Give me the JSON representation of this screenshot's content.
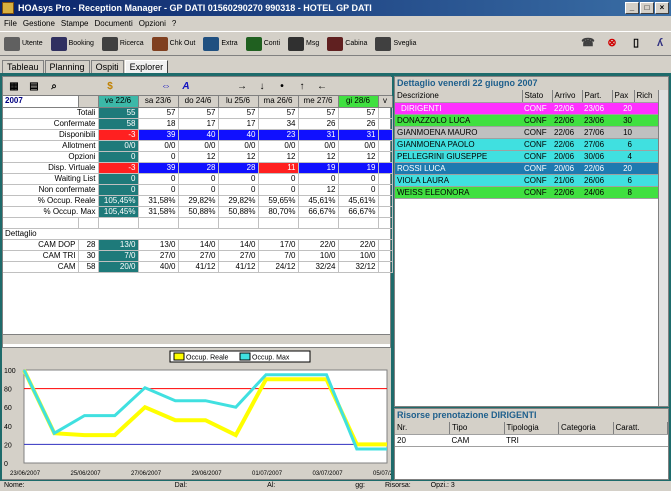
{
  "window": {
    "title": "HOAsys Pro - Reception Manager - GP DATI 01560290270 990318 - HOTEL GP DATI"
  },
  "menu": [
    "File",
    "Gestione",
    "Stampe",
    "Documenti",
    "Opzioni",
    "?"
  ],
  "toolbar": [
    {
      "label": "Utente",
      "color": "#606060"
    },
    {
      "label": "Booking",
      "color": "#303060"
    },
    {
      "label": "Ricerca",
      "color": "#404040"
    },
    {
      "label": "Chk Out",
      "color": "#804020"
    },
    {
      "label": "Extra",
      "color": "#205080"
    },
    {
      "label": "Conti",
      "color": "#206020"
    },
    {
      "label": "Msg",
      "color": "#303030"
    },
    {
      "label": "Cabina",
      "color": "#602020"
    },
    {
      "label": "Sveglia",
      "color": "#404040"
    }
  ],
  "tabs": [
    "Tableau",
    "Planning",
    "Ospiti",
    "Explorer"
  ],
  "active_tab": "Explorer",
  "grid": {
    "year": "2007",
    "columns": [
      "ve 22/6",
      "sa 23/6",
      "do 24/6",
      "lu 25/6",
      "ma 26/6",
      "me 27/6",
      "gi 28/6",
      "v"
    ],
    "rows": [
      {
        "label": "Totali",
        "cells": [
          "55",
          "57",
          "57",
          "57",
          "57",
          "57",
          "57"
        ]
      },
      {
        "label": "Confermate",
        "cells": [
          "58",
          "18",
          "17",
          "17",
          "34",
          "26",
          "26"
        ]
      },
      {
        "label": "Disponibili",
        "cells": [
          "-3",
          "39",
          "40",
          "40",
          "23",
          "31",
          "31"
        ]
      },
      {
        "label": "Allotment",
        "cells": [
          "0/0",
          "0/0",
          "0/0",
          "0/0",
          "0/0",
          "0/0",
          "0/0"
        ]
      },
      {
        "label": "Opzioni",
        "cells": [
          "0",
          "0",
          "12",
          "12",
          "12",
          "12",
          "12"
        ]
      },
      {
        "label": "Disp. Virtuale",
        "cells": [
          "-3",
          "39",
          "28",
          "28",
          "11",
          "19",
          "19"
        ]
      },
      {
        "label": "Waiting List",
        "cells": [
          "0",
          "0",
          "0",
          "0",
          "0",
          "0",
          "0"
        ]
      },
      {
        "label": "Non confermate",
        "cells": [
          "0",
          "0",
          "0",
          "0",
          "0",
          "12",
          "0"
        ]
      },
      {
        "label": "% Occup. Reale",
        "cells": [
          "105,45%",
          "31,58%",
          "29,82%",
          "29,82%",
          "59,65%",
          "45,61%",
          "45,61%"
        ]
      },
      {
        "label": "% Occup. Max",
        "cells": [
          "105,45%",
          "31,58%",
          "50,88%",
          "50,88%",
          "80,70%",
          "66,67%",
          "66,67%"
        ]
      }
    ],
    "section": "Dettaglio",
    "detail": [
      {
        "label": "CAM DOP",
        "count": "28",
        "cells": [
          "13/0",
          "13/0",
          "14/0",
          "14/0",
          "17/0",
          "22/0",
          "22/0"
        ]
      },
      {
        "label": "CAM TRI",
        "count": "30",
        "cells": [
          "7/0",
          "27/0",
          "27/0",
          "27/0",
          "7/0",
          "10/0",
          "10/0"
        ]
      },
      {
        "label": "CAM",
        "count": "58",
        "cells": [
          "20/0",
          "40/0",
          "41/12",
          "41/12",
          "24/12",
          "32/24",
          "32/12"
        ]
      }
    ]
  },
  "chart_data": {
    "type": "line",
    "x": [
      "23/06/2007",
      "25/06/2007",
      "27/06/2007",
      "29/06/2007",
      "01/07/2007",
      "03/07/2007",
      "05/07/2007"
    ],
    "series": [
      {
        "name": "Occup. Reale",
        "color": "#ffff00",
        "values": [
          105,
          32,
          30,
          30,
          60,
          46,
          46,
          30,
          90,
          90,
          90,
          20,
          20
        ]
      },
      {
        "name": "Occup. Max",
        "color": "#40e0e0",
        "values": [
          105,
          32,
          51,
          51,
          81,
          67,
          67,
          60,
          95,
          95,
          95,
          15,
          15
        ]
      }
    ],
    "ylim": [
      0,
      100
    ],
    "yticks": [
      "100",
      "80",
      "60",
      "40",
      "20",
      "0"
    ]
  },
  "right": {
    "title": "Dettaglio venerdi 22 giugno 2007",
    "headers": [
      "Descrizione",
      "Stato",
      "Arrivo",
      "Part.",
      "Pax",
      "Rich"
    ],
    "rows": [
      {
        "desc": "DIRIGENTI",
        "stato": "CONF",
        "arrivo": "22/06",
        "part": "23/06",
        "pax": "20",
        "bg": "#ff30ff",
        "fg": "#ffffff"
      },
      {
        "desc": "DONAZZOLO LUCA",
        "stato": "CONF",
        "arrivo": "22/06",
        "part": "23/06",
        "pax": "30",
        "bg": "#40e040",
        "fg": "#000000"
      },
      {
        "desc": "GIANMOENA MAURO",
        "stato": "CONF",
        "arrivo": "22/06",
        "part": "27/06",
        "pax": "10",
        "bg": "#c0c0c0",
        "fg": "#000000"
      },
      {
        "desc": "GIANMOENA PAOLO",
        "stato": "CONF",
        "arrivo": "22/06",
        "part": "27/06",
        "pax": "6",
        "bg": "#40e0e0",
        "fg": "#000000"
      },
      {
        "desc": "PELLEGRINI GIUSEPPE",
        "stato": "CONF",
        "arrivo": "20/06",
        "part": "30/06",
        "pax": "4",
        "bg": "#40e0e0",
        "fg": "#000000"
      },
      {
        "desc": "ROSSI LUCA",
        "stato": "CONF",
        "arrivo": "20/06",
        "part": "22/06",
        "pax": "20",
        "bg": "#1e7ab0",
        "fg": "#ffffff"
      },
      {
        "desc": "VIOLA LAURA",
        "stato": "CONF",
        "arrivo": "21/06",
        "part": "26/06",
        "pax": "6",
        "bg": "#40e0e0",
        "fg": "#000000"
      },
      {
        "desc": "WEISS ELEONORA",
        "stato": "CONF",
        "arrivo": "22/06",
        "part": "24/06",
        "pax": "8",
        "bg": "#40e040",
        "fg": "#000000"
      }
    ],
    "resources_title": "Risorse prenotazione DIRIGENTI",
    "res_headers": [
      "Nr.",
      "Tipo",
      "Tipologia",
      "Categoria",
      "Caratt."
    ],
    "res_rows": [
      {
        "nr": "20",
        "tipo": "CAM",
        "tipologia": "TRI"
      }
    ]
  },
  "status": {
    "nome": "Nome:",
    "dal": "Dal:",
    "al": "Al:",
    "gg": "gg:",
    "risorsa": "Risorsa:",
    "opzi": "Opzi.: 3"
  }
}
